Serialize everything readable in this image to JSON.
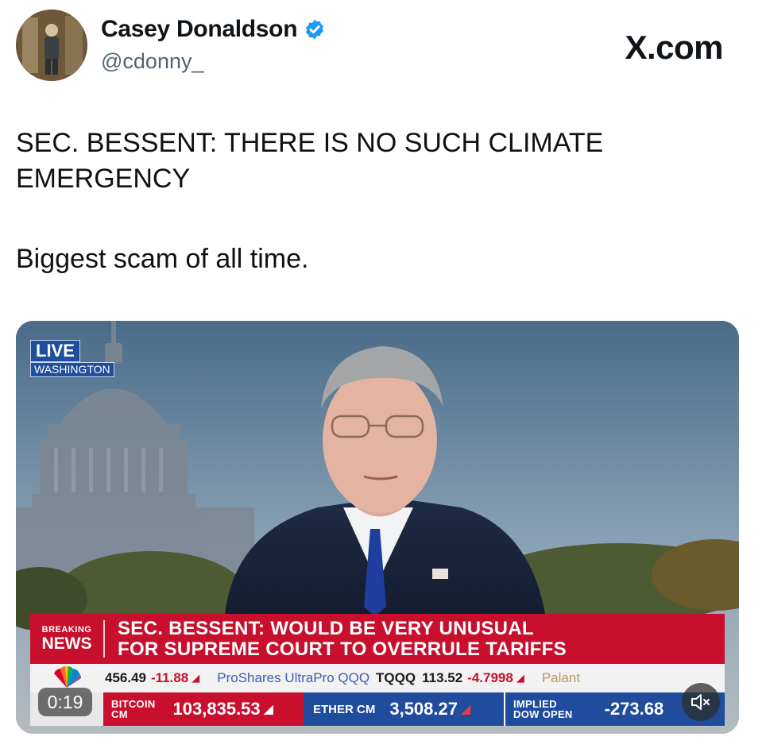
{
  "header": {
    "display_name": "Casey Donaldson",
    "handle": "@cdonny_",
    "source_label": "X.com",
    "verified": true
  },
  "tweet": {
    "line_1": "SEC. BESSENT: THERE IS NO SUCH CLIMATE EMERGENCY",
    "line_2": "Biggest scam of all time."
  },
  "video": {
    "live_label": "LIVE",
    "location_label": "WASHINGTON",
    "elapsed_time": "0:19",
    "breaking": {
      "small_label": "BREAKING",
      "big_label": "NEWS",
      "headline_line_1": "SEC. BESSENT: WOULD BE VERY UNUSUAL",
      "headline_line_2": "FOR SUPREME COURT TO OVERRULE TARIFFS"
    },
    "ticker": {
      "stock_value": "456.49",
      "stock_change": "-11.88",
      "fund_name": "ProShares UltraPro QQQ",
      "fund_symbol": "TQQQ",
      "fund_value": "113.52",
      "fund_change": "-4.7998",
      "next_item": "Palant"
    },
    "crypto": {
      "bitcoin_label_1": "BITCOIN",
      "bitcoin_label_2": "CM",
      "bitcoin_value": "103,835.53",
      "ether_label": "ETHER CM",
      "ether_value": "3,508.27",
      "dow_label_1": "IMPLIED",
      "dow_label_2": "DOW OPEN",
      "dow_value": "-273.68"
    }
  },
  "colors": {
    "breaking_red": "#c8102e",
    "ticker_blue": "#1f4c9c",
    "verified_blue": "#1d9bf0"
  },
  "icons": {
    "verified": "verified-badge-icon",
    "mute": "speaker-muted-icon",
    "network_logo": "peacock-logo-icon"
  }
}
